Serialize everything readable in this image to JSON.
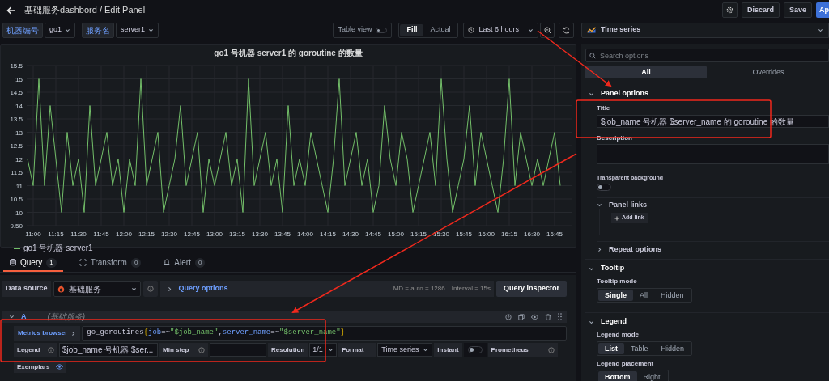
{
  "header": {
    "title": "基础服务dashbord / Edit Panel",
    "buttons": [
      {
        "kind": "icon"
      },
      {
        "kind": "text",
        "label": "Discard"
      },
      {
        "kind": "text",
        "label": "Save"
      },
      {
        "kind": "primary",
        "label": "Ap"
      }
    ]
  },
  "variables": [
    {
      "label": "机器编号",
      "value": "go1"
    },
    {
      "label": "服务名",
      "value": "server1"
    }
  ],
  "toolbar": {
    "table_view": {
      "label": "Table view",
      "on": false
    },
    "fit": [
      {
        "label": "Fill",
        "selected": true
      },
      {
        "label": "Actual",
        "selected": false
      }
    ],
    "time_range": "Last 6 hours"
  },
  "visualization": "Time series",
  "panel": {
    "title": "go1 号机器 server1 的 goroutine 的数量",
    "chart_data": {
      "type": "line",
      "grid": true,
      "ylim": [
        9.5,
        15.5
      ],
      "yticks": [
        15.5,
        15,
        14.5,
        14,
        13.5,
        13,
        12.5,
        12,
        11.5,
        11,
        10.5,
        10,
        {
          "value": 9.5,
          "label": "9.50"
        }
      ],
      "categories": [
        null,
        "11:00",
        null,
        null,
        null,
        "11:15",
        null,
        null,
        null,
        "11:30",
        null,
        null,
        null,
        "11:45",
        null,
        null,
        null,
        "12:00",
        null,
        null,
        null,
        "12:15",
        null,
        null,
        null,
        "12:30",
        null,
        null,
        null,
        "12:45",
        null,
        null,
        null,
        "13:00",
        null,
        null,
        null,
        "13:15",
        null,
        null,
        null,
        "13:30",
        null,
        null,
        null,
        "13:45",
        null,
        null,
        null,
        "14:00",
        null,
        null,
        null,
        "14:15",
        null,
        null,
        null,
        "14:30",
        null,
        null,
        null,
        "14:45",
        null,
        null,
        null,
        "15:00",
        null,
        null,
        null,
        "15:15",
        null,
        null,
        null,
        "15:30",
        null,
        null,
        null,
        "15:45",
        null,
        null,
        null,
        "16:00",
        null,
        null,
        null,
        "16:15",
        null,
        null,
        null,
        "16:30",
        null,
        null,
        null,
        "16:45",
        null
      ],
      "series": [
        {
          "name": "go1 号机器 server1",
          "color": "#73bf69",
          "values": [
            12,
            11,
            15,
            11,
            14,
            12,
            10,
            13,
            11,
            12,
            10,
            14,
            11,
            12,
            13,
            11,
            12,
            10,
            12,
            11,
            15,
            11,
            12,
            13,
            10,
            11,
            12,
            14,
            11,
            12,
            13,
            10,
            12,
            11,
            12,
            13,
            11,
            12,
            10,
            15,
            11,
            12,
            13,
            11,
            12,
            10,
            14,
            11,
            12,
            11,
            13,
            12,
            11,
            10,
            12,
            15,
            11,
            12,
            13,
            11,
            12,
            10,
            11,
            14,
            12,
            11,
            13,
            12,
            10,
            11,
            12,
            13,
            11,
            15,
            12,
            10,
            11,
            12,
            14,
            11,
            13,
            12,
            11,
            10,
            12,
            15,
            11,
            13,
            12,
            11,
            12,
            11,
            12,
            13,
            11
          ]
        }
      ]
    }
  },
  "query_tabs": [
    {
      "label": "Query",
      "count": "1",
      "selected": true,
      "kind": "query"
    },
    {
      "label": "Transform",
      "count": "0",
      "selected": false,
      "kind": "transform"
    },
    {
      "label": "Alert",
      "count": "0",
      "selected": false,
      "kind": "alert"
    }
  ],
  "data_source": {
    "label": "Data source",
    "value": "基础服务",
    "query_options": "Query options",
    "md": "MD = auto = 1286",
    "interval": "Interval = 15s",
    "inspector": "Query inspector"
  },
  "query": {
    "ref": "A",
    "source": "(基础服务)",
    "metrics_browser": "Metrics browser",
    "code": [
      {
        "kind": "plain",
        "text": "go_goroutines"
      },
      {
        "kind": "brace",
        "text": "{"
      },
      {
        "kind": "label",
        "text": "job"
      },
      {
        "kind": "plain",
        "text": "=~"
      },
      {
        "kind": "string",
        "text": "\"$job_name\""
      },
      {
        "kind": "plain",
        "text": ","
      },
      {
        "kind": "label",
        "text": "server_name"
      },
      {
        "kind": "plain",
        "text": "=~"
      },
      {
        "kind": "string",
        "text": "\"$server_name\""
      },
      {
        "kind": "brace",
        "text": "}"
      }
    ],
    "legend_label": "Legend",
    "legend_value": "$job_name 号机器 $ser...",
    "min_step": "Min step",
    "resolution_label": "Resolution",
    "resolution": "1/1",
    "format_label": "Format",
    "format": "Time series",
    "instant_label": "Instant",
    "instant": false,
    "prometheus": "Prometheus",
    "exemplars": "Exemplars"
  },
  "options": {
    "search_placeholder": "Search options",
    "tabs": [
      {
        "label": "All",
        "selected": true
      },
      {
        "label": "Overrides",
        "selected": false
      }
    ],
    "panel_options": "Panel options",
    "title_label": "Title",
    "title_value": "$job_name 号机器 $server_name 的 goroutine 的数量",
    "description_label": "Description",
    "transparent_label": "Transparent background",
    "transparent": false,
    "panel_links": "Panel links",
    "add_link": "Add link",
    "repeat_options": "Repeat options",
    "tooltip": "Tooltip",
    "tooltip_mode_label": "Tooltip mode",
    "tooltip_modes": [
      {
        "label": "Single",
        "selected": true
      },
      {
        "label": "All",
        "selected": false
      },
      {
        "label": "Hidden",
        "selected": false
      }
    ],
    "legend": "Legend",
    "legend_mode_label": "Legend mode",
    "legend_modes": [
      {
        "label": "List",
        "selected": true
      },
      {
        "label": "Table",
        "selected": false
      },
      {
        "label": "Hidden",
        "selected": false
      }
    ],
    "legend_placement_label": "Legend placement",
    "legend_placements": [
      {
        "label": "Bottom",
        "selected": true
      },
      {
        "label": "Right",
        "selected": false
      }
    ]
  }
}
